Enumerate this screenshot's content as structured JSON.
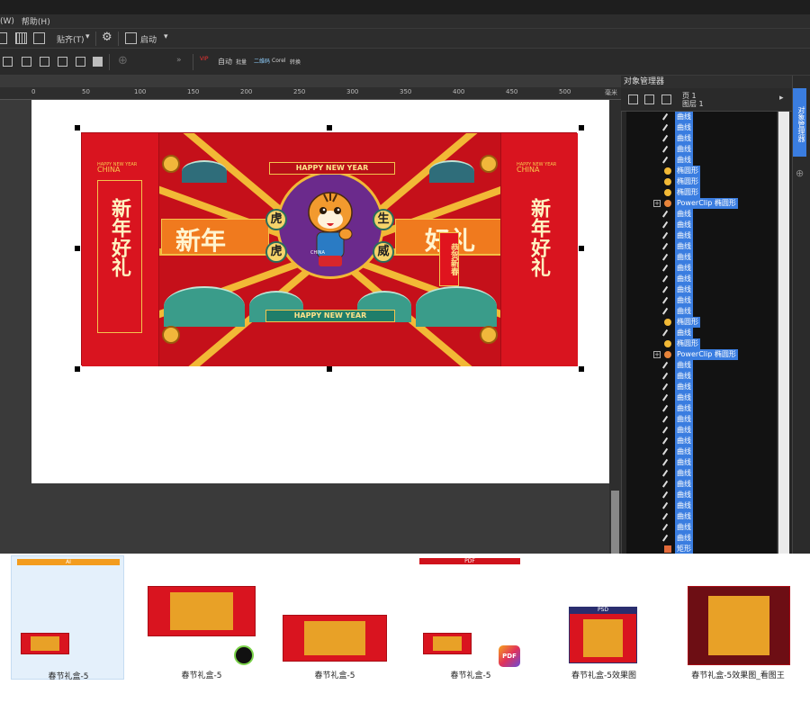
{
  "menu": {
    "items": [
      "(W)",
      "帮助(H)"
    ]
  },
  "toolbar1": {
    "snap_label": "贴齐(T)",
    "launch_label": "启动"
  },
  "toolbar2": {
    "vip_label": "VIP",
    "text_icons": [
      "自动",
      "批量",
      "二维码",
      "Corel",
      "转换"
    ]
  },
  "ruler": {
    "ticks": [
      "0",
      "50",
      "100",
      "150",
      "200",
      "250",
      "300",
      "350",
      "400",
      "450",
      "500"
    ],
    "unit": "毫米"
  },
  "docker": {
    "title": "对象管理器",
    "page": "页 1",
    "layer": "图层 1",
    "rail_tab": "对象管理器",
    "objects": [
      {
        "type": "curve",
        "label": "曲线"
      },
      {
        "type": "curve",
        "label": "曲线"
      },
      {
        "type": "curve",
        "label": "曲线"
      },
      {
        "type": "curve",
        "label": "曲线"
      },
      {
        "type": "curve",
        "label": "曲线"
      },
      {
        "type": "ellipse",
        "label": "椭圆形"
      },
      {
        "type": "ellipse",
        "label": "椭圆形"
      },
      {
        "type": "ellipse",
        "label": "椭圆形"
      },
      {
        "type": "powerclip",
        "label": "PowerClip 椭圆形"
      },
      {
        "type": "curve",
        "label": "曲线"
      },
      {
        "type": "curve",
        "label": "曲线"
      },
      {
        "type": "curve",
        "label": "曲线"
      },
      {
        "type": "curve",
        "label": "曲线"
      },
      {
        "type": "curve",
        "label": "曲线"
      },
      {
        "type": "curve",
        "label": "曲线"
      },
      {
        "type": "curve",
        "label": "曲线"
      },
      {
        "type": "curve",
        "label": "曲线"
      },
      {
        "type": "curve",
        "label": "曲线"
      },
      {
        "type": "curve",
        "label": "曲线"
      },
      {
        "type": "ellipse",
        "label": "椭圆形"
      },
      {
        "type": "curve",
        "label": "曲线"
      },
      {
        "type": "ellipse",
        "label": "椭圆形"
      },
      {
        "type": "powerclip",
        "label": "PowerClip 椭圆形"
      },
      {
        "type": "curve",
        "label": "曲线"
      },
      {
        "type": "curve",
        "label": "曲线"
      },
      {
        "type": "curve",
        "label": "曲线"
      },
      {
        "type": "curve",
        "label": "曲线"
      },
      {
        "type": "curve",
        "label": "曲线"
      },
      {
        "type": "curve",
        "label": "曲线"
      },
      {
        "type": "curve",
        "label": "曲线"
      },
      {
        "type": "curve",
        "label": "曲线"
      },
      {
        "type": "curve",
        "label": "曲线"
      },
      {
        "type": "curve",
        "label": "曲线"
      },
      {
        "type": "curve",
        "label": "曲线"
      },
      {
        "type": "curve",
        "label": "曲线"
      },
      {
        "type": "curve",
        "label": "曲线"
      },
      {
        "type": "curve",
        "label": "曲线"
      },
      {
        "type": "curve",
        "label": "曲线"
      },
      {
        "type": "curve",
        "label": "曲线"
      },
      {
        "type": "curve",
        "label": "曲线"
      },
      {
        "type": "rect",
        "label": "矩形"
      }
    ]
  },
  "artwork": {
    "side_title": "新年好礼",
    "side_caption_top": "HAPPY NEW YEAR",
    "side_caption_china": "CHINA",
    "banner_top": "HAPPY NEW YEAR",
    "banner_bottom": "HAPPY NEW YEAR",
    "left_big": "新年",
    "right_big": "好礼",
    "badges": [
      "虎",
      "虎",
      "生",
      "威"
    ],
    "scroll_text": "恭贺新春",
    "china_small": "CHINA"
  },
  "thumbnails": [
    {
      "caption": "春节礼盒-5",
      "badge": "AI",
      "badge_color": "#f39c1e",
      "selected": true
    },
    {
      "caption": "春节礼盒-5",
      "badge": "",
      "badge_color": "",
      "selected": false
    },
    {
      "caption": "春节礼盒-5",
      "badge": "",
      "badge_color": "",
      "selected": false
    },
    {
      "caption": "春节礼盒-5",
      "badge": "PDF",
      "badge_color": "#d0121b",
      "selected": false
    },
    {
      "caption": "春节礼盒-5效果图",
      "badge": "PSD",
      "badge_color": "#2a2d6e",
      "selected": false
    },
    {
      "caption": "春节礼盒-5效果图_看图王",
      "badge": "",
      "badge_color": "",
      "selected": false
    }
  ],
  "colors": {
    "accent_blue": "#3a7de0",
    "box_red": "#d9141f",
    "gold": "#f3c44d"
  }
}
